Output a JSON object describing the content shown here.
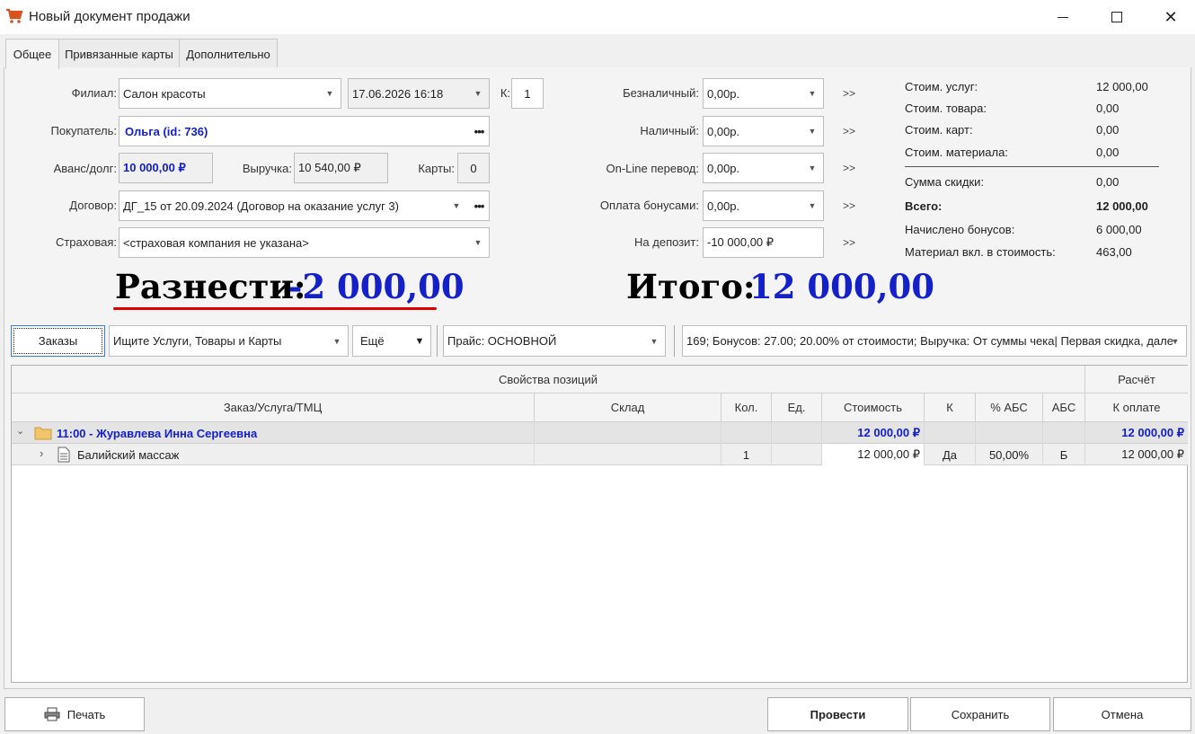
{
  "window": {
    "title": "Новый документ продажи"
  },
  "tabs": [
    "Общее",
    "Привязанные карты",
    "Дополнительно"
  ],
  "form": {
    "filial_label": "Филиал:",
    "filial_value": "Салон красоты",
    "datetime": "17.06.2026 16:18",
    "k_label": "К:",
    "k_value": "1",
    "buyer_label": "Покупатель:",
    "buyer_value": "Ольга  (id: 736)",
    "advance_label": "Аванс/долг:",
    "advance_value": "10 000,00 ₽",
    "revenue_label": "Выручка:",
    "revenue_value": "10 540,00 ₽",
    "cards_label": "Карты:",
    "cards_value": "0",
    "contract_label": "Договор:",
    "contract_value": "ДГ_15 от 20.09.2024 (Договор на оказание услуг 3)",
    "insurance_label": "Страховая:",
    "insurance_value": "<страховая компания не указана>"
  },
  "payments": [
    {
      "label": "Безналичный:",
      "value": "0,00р."
    },
    {
      "label": "Наличный:",
      "value": "0,00р."
    },
    {
      "label": "On-Line перевод:",
      "value": "0,00р."
    },
    {
      "label": "Оплата бонусами:",
      "value": "0,00р."
    },
    {
      "label": "На депозит:",
      "value": "-10 000,00 ₽"
    }
  ],
  "arrows_label": ">>",
  "summary": {
    "services_label": "Стоим. услуг:",
    "services_value": "12 000,00",
    "goods_label": "Стоим. товара:",
    "goods_value": "0,00",
    "cards_label": "Стоим. карт:",
    "cards_value": "0,00",
    "material_label": "Стоим. материала:",
    "material_value": "0,00",
    "discount_label": "Сумма скидки:",
    "discount_value": "0,00",
    "total_label": "Всего:",
    "total_value": "12 000,00",
    "bonus_label": "Начислено бонусов:",
    "bonus_value": "6 000,00",
    "matincl_label": "Материал вкл. в стоимость:",
    "matincl_value": "463,00"
  },
  "big": {
    "distribute_label": "Разнести:",
    "distribute_value": "-2 000,00",
    "total_label": "Итого:",
    "total_value": "12 000,00"
  },
  "toolbar": {
    "orders_button": "Заказы",
    "search_value": "Ищите Услуги, Товары и Карты",
    "more_label": "Ещё",
    "price_value": "Прайс: ОСНОВНОЙ",
    "promo_value": "169; Бонусов: 27.00; 20.00% от стоимости; Выручка: От суммы чека| Первая скидка, дале"
  },
  "grid": {
    "group_left": "Свойства позиций",
    "group_right": "Расчёт",
    "columns": [
      "Заказ/Услуга/ТМЦ",
      "Склад",
      "Кол.",
      "Ед.",
      "Стоимость",
      "К",
      "% АБС",
      "АБС",
      "К оплате"
    ],
    "group_row": {
      "title": "11:00 - Журавлева Инна Сергеевна",
      "cost": "12 000,00 ₽",
      "to_pay": "12 000,00 ₽"
    },
    "rows": [
      {
        "name": "Балийский массаж",
        "qty": "1",
        "cost": "12 000,00 ₽",
        "k": "Да",
        "abs_pct": "50,00%",
        "abs": "Б",
        "to_pay": "12 000,00 ₽"
      }
    ]
  },
  "footer": {
    "print": "Печать",
    "post": "Провести",
    "save": "Сохранить",
    "cancel": "Отмена"
  },
  "colors": {
    "accent_blue": "#1420c8",
    "underline_red": "#e00000"
  }
}
